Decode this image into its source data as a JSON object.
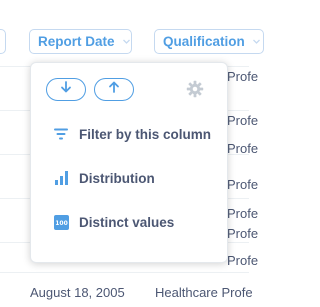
{
  "header": {
    "columns": [
      {
        "label": "Report Date"
      },
      {
        "label": "Qualification"
      }
    ]
  },
  "rows": {
    "right_cells": [
      "Profe",
      "Profe",
      "Profe",
      "Profe",
      "Profe",
      "Profe",
      "Profe"
    ],
    "bottom_date": "August 18, 2005",
    "bottom_qual": "Healthcare Profe"
  },
  "popover": {
    "sort_desc_icon": "arrow-down-icon",
    "sort_asc_icon": "arrow-up-icon",
    "settings_icon": "gear-icon",
    "items": [
      {
        "label": "Filter by this column",
        "icon": "filter-icon"
      },
      {
        "label": "Distribution",
        "icon": "bar-chart-icon"
      },
      {
        "label": "Distinct values",
        "icon": "number-100-icon"
      }
    ]
  },
  "colors": {
    "accent": "#509ee3",
    "text": "#4c5773",
    "gear": "#c4cbd3",
    "border": "#c5d9f0"
  }
}
